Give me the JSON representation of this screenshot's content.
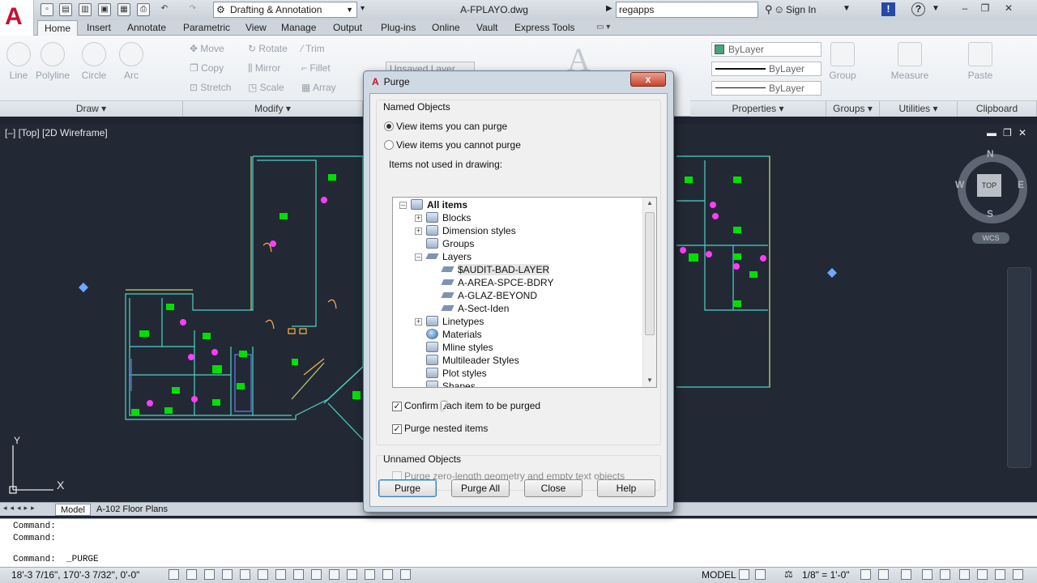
{
  "title_bar": {
    "workspace": "Drafting & Annotation",
    "document": "A-FPLAYO.dwg",
    "search_value": "regapps",
    "sign_in": "Sign In"
  },
  "ribbon_tabs": [
    "Home",
    "Insert",
    "Annotate",
    "Parametric",
    "View",
    "Manage",
    "Output",
    "Plug-ins",
    "Online",
    "Vault",
    "Express Tools"
  ],
  "active_tab": "Home",
  "draw_panel": {
    "title": "Draw",
    "tools": [
      "Line",
      "Polyline",
      "Circle",
      "Arc"
    ]
  },
  "modify_panel": {
    "title": "Modify",
    "tools": [
      "Move",
      "Rotate",
      "Trim",
      "Copy",
      "Mirror",
      "Fillet",
      "Stretch",
      "Scale",
      "Array"
    ]
  },
  "layers_panel": {
    "state": "Unsaved Layer State"
  },
  "properties_panel": {
    "title": "Properties",
    "color": "ByLayer",
    "linetype": "ByLayer",
    "lineweight": "ByLayer"
  },
  "groups_panel": {
    "title": "Groups",
    "tool": "Group"
  },
  "utilities_panel": {
    "title": "Utilities",
    "tool": "Measure"
  },
  "clipboard_panel": {
    "title": "Clipboard",
    "tool": "Paste"
  },
  "viewport": {
    "label": "[–] [Top] [2D Wireframe]",
    "viewcube_top": "TOP",
    "compass": {
      "n": "N",
      "s": "S",
      "e": "E",
      "w": "W"
    },
    "wcs": "WCS",
    "ucs_y": "Y",
    "ucs_x": "X"
  },
  "layout_tabs": [
    "Model",
    "A-102 Floor Plans"
  ],
  "command_history": [
    "Command:",
    "Command:"
  ],
  "command_current": "Command:  _PURGE",
  "status_bar": {
    "coordinates": "18'-3 7/16\", 170'-3 7/32\", 0'-0\"",
    "space": "MODEL",
    "scale": "1/8\" = 1'-0\""
  },
  "dialog": {
    "title": "Purge",
    "close": "x",
    "named_group": "Named Objects",
    "radio_can": "View items you can purge",
    "radio_cannot": "View items you cannot purge",
    "tree_label": "Items not used in drawing:",
    "tree": {
      "root": "All items",
      "blocks": "Blocks",
      "dim_styles": "Dimension styles",
      "groups": "Groups",
      "layers": "Layers",
      "layer_items": [
        "$AUDIT-BAD-LAYER",
        "A-AREA-SPCE-BDRY",
        "A-GLAZ-BEYOND",
        "A-Sect-Iden"
      ],
      "linetypes": "Linetypes",
      "materials": "Materials",
      "mline": "Mline styles",
      "multileader": "Multileader Styles",
      "plot_styles": "Plot styles",
      "shapes": "Shapes"
    },
    "confirm_label": "Confirm each item to be purged",
    "confirm_checked": true,
    "nested_label": "Purge nested items",
    "nested_checked": true,
    "unnamed_group": "Unnamed Objects",
    "zero_length_label": "Purge zero-length geometry and empty text objects",
    "buttons": {
      "purge": "Purge",
      "purge_all": "Purge All",
      "close": "Close",
      "help": "Help"
    }
  },
  "colors": {
    "accent": "#c8102e",
    "cad_background": "#222935",
    "drawing_lines": "#4fd1c5",
    "drawing_fill": "#00e000",
    "door_marks": "#ff3cff"
  }
}
